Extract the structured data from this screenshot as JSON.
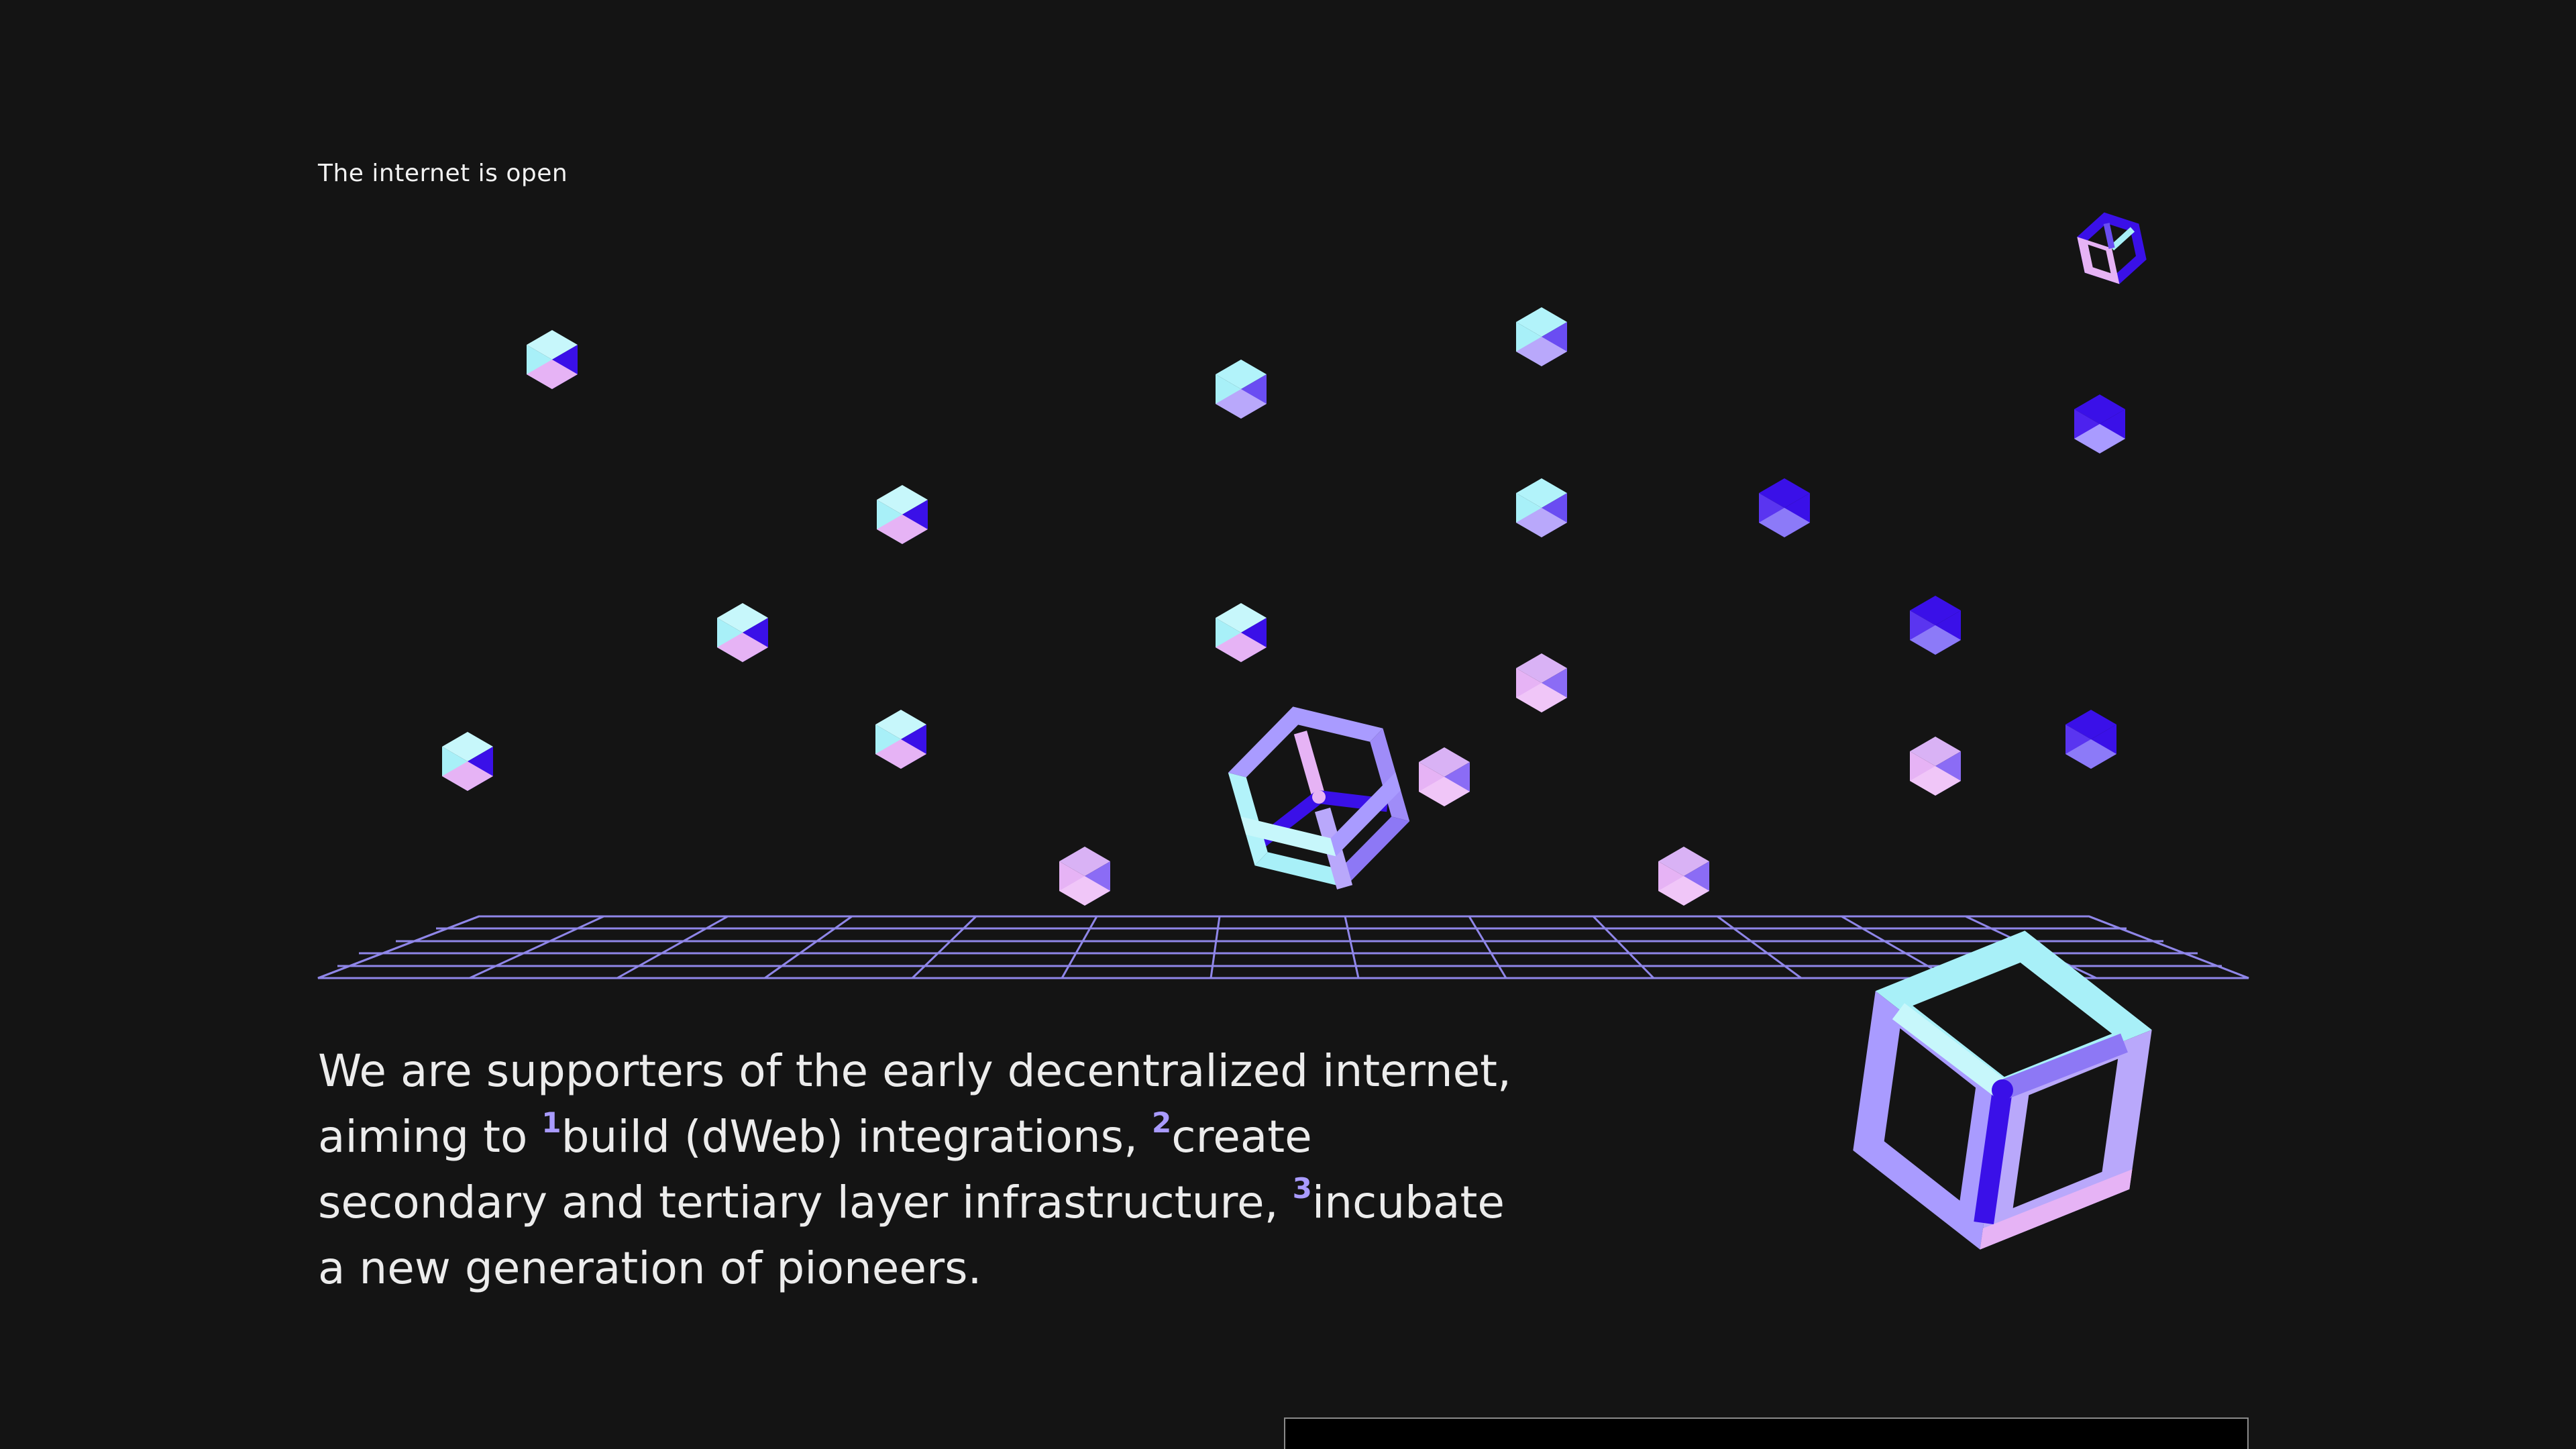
{
  "hero": {
    "eyebrow": "The internet is open"
  },
  "mission": {
    "line1": "We are supporters of the early decentralized internet,",
    "line2_pre": "aiming to ",
    "marker1": "1",
    "phrase1": "build (dWeb) integrations, ",
    "marker2": "2",
    "phrase2": "create",
    "line3_pre": "secondary and tertiary layer infrastructure, ",
    "marker3": "3",
    "phrase3": "incubate",
    "line4": "a new generation of pioneers."
  },
  "colors": {
    "background": "#141414",
    "cyan": "#a8f0f8",
    "lavender": "#a99bff",
    "pink": "#e6b3f5",
    "indigo": "#3a10e8",
    "grid": "#8f86e8"
  },
  "icons": {
    "small_cube": "isometric-cube-icon",
    "wireframe_cube": "hollow-cube-icon"
  }
}
